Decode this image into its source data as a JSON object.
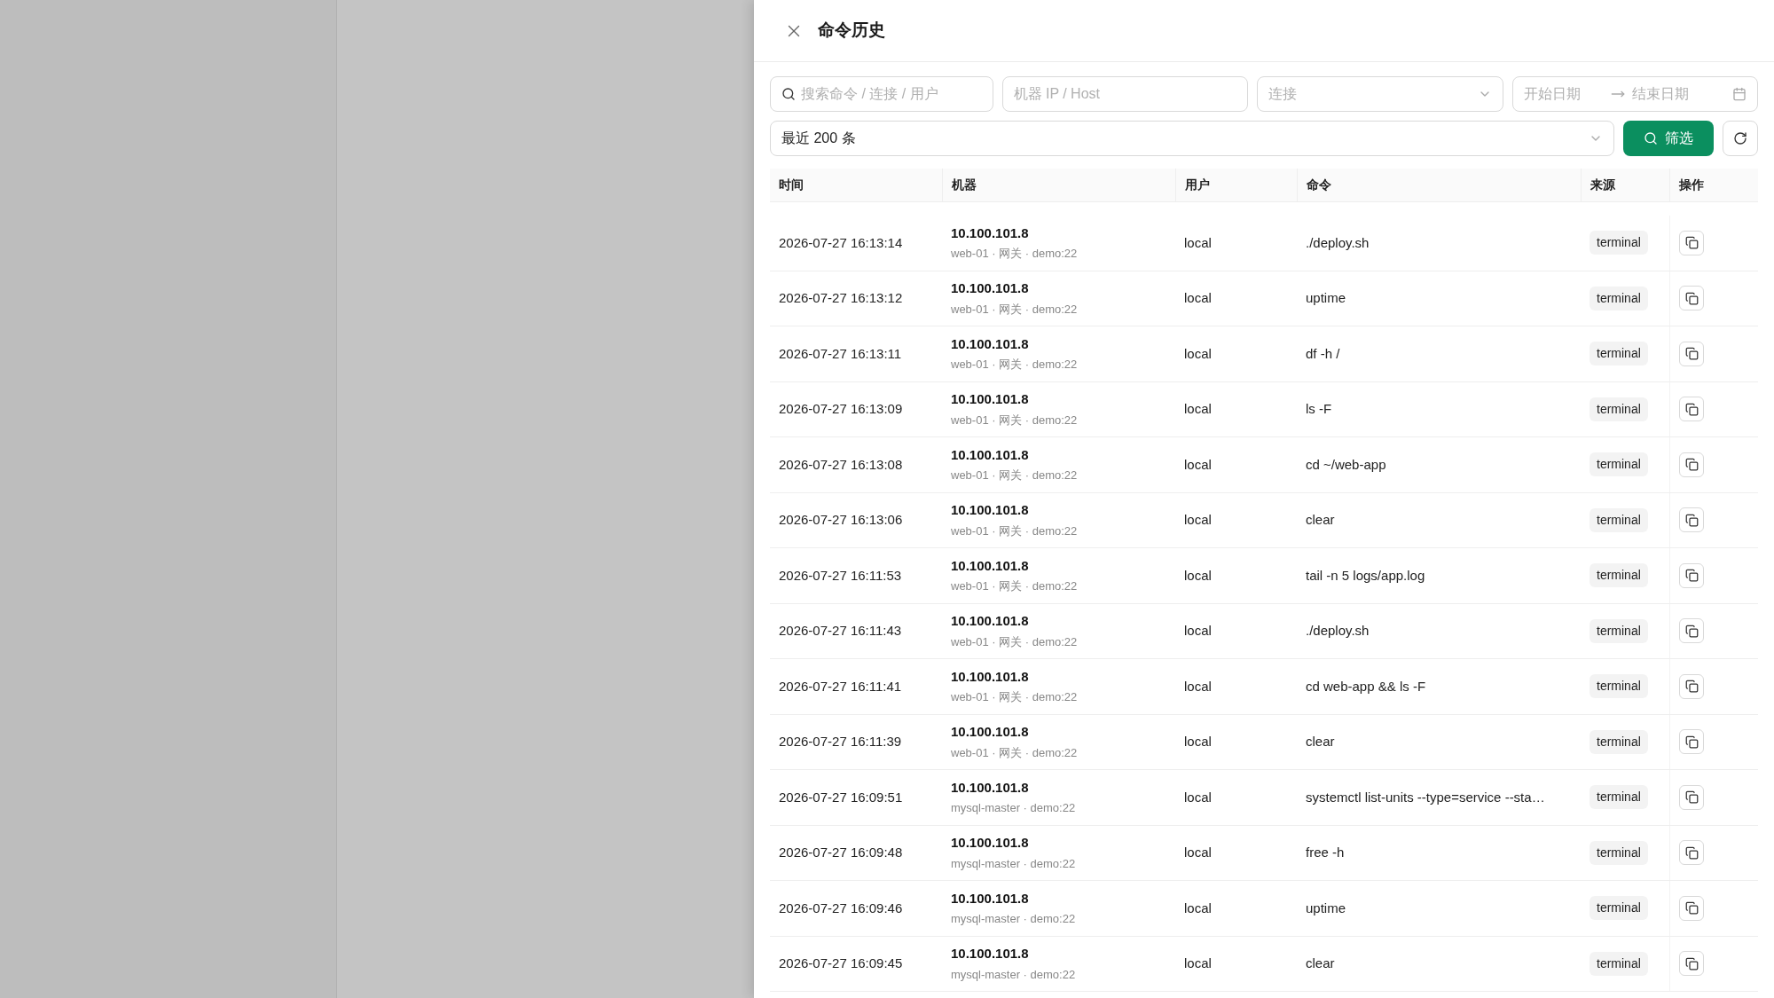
{
  "drawer": {
    "title": "命令历史"
  },
  "filters": {
    "search": {
      "placeholder": "搜索命令 / 连接 / 用户"
    },
    "host": {
      "placeholder": "机器 IP / Host"
    },
    "connection": {
      "placeholder": "连接"
    },
    "date_range": {
      "start_placeholder": "开始日期",
      "end_placeholder": "结束日期"
    },
    "limit": {
      "value": "最近 200 条"
    },
    "filter_button": "筛选"
  },
  "table": {
    "columns": [
      "时间",
      "机器",
      "用户",
      "命令",
      "来源",
      "操作"
    ],
    "rows": [
      {
        "time": "2026-07-27 16:13:14",
        "ip": "10.100.101.8",
        "machine": "web-01 · 网关 · demo:22",
        "user": "local",
        "command": "./deploy.sh",
        "source": "terminal"
      },
      {
        "time": "2026-07-27 16:13:12",
        "ip": "10.100.101.8",
        "machine": "web-01 · 网关 · demo:22",
        "user": "local",
        "command": "uptime",
        "source": "terminal"
      },
      {
        "time": "2026-07-27 16:13:11",
        "ip": "10.100.101.8",
        "machine": "web-01 · 网关 · demo:22",
        "user": "local",
        "command": "df -h /",
        "source": "terminal"
      },
      {
        "time": "2026-07-27 16:13:09",
        "ip": "10.100.101.8",
        "machine": "web-01 · 网关 · demo:22",
        "user": "local",
        "command": "ls -F",
        "source": "terminal"
      },
      {
        "time": "2026-07-27 16:13:08",
        "ip": "10.100.101.8",
        "machine": "web-01 · 网关 · demo:22",
        "user": "local",
        "command": "cd ~/web-app",
        "source": "terminal"
      },
      {
        "time": "2026-07-27 16:13:06",
        "ip": "10.100.101.8",
        "machine": "web-01 · 网关 · demo:22",
        "user": "local",
        "command": "clear",
        "source": "terminal"
      },
      {
        "time": "2026-07-27 16:11:53",
        "ip": "10.100.101.8",
        "machine": "web-01 · 网关 · demo:22",
        "user": "local",
        "command": "tail -n 5 logs/app.log",
        "source": "terminal"
      },
      {
        "time": "2026-07-27 16:11:43",
        "ip": "10.100.101.8",
        "machine": "web-01 · 网关 · demo:22",
        "user": "local",
        "command": "./deploy.sh",
        "source": "terminal"
      },
      {
        "time": "2026-07-27 16:11:41",
        "ip": "10.100.101.8",
        "machine": "web-01 · 网关 · demo:22",
        "user": "local",
        "command": "cd web-app && ls -F",
        "source": "terminal"
      },
      {
        "time": "2026-07-27 16:11:39",
        "ip": "10.100.101.8",
        "machine": "web-01 · 网关 · demo:22",
        "user": "local",
        "command": "clear",
        "source": "terminal"
      },
      {
        "time": "2026-07-27 16:09:51",
        "ip": "10.100.101.8",
        "machine": "mysql-master · demo:22",
        "user": "local",
        "command": "systemctl list-units --type=service --sta…",
        "source": "terminal"
      },
      {
        "time": "2026-07-27 16:09:48",
        "ip": "10.100.101.8",
        "machine": "mysql-master · demo:22",
        "user": "local",
        "command": "free -h",
        "source": "terminal"
      },
      {
        "time": "2026-07-27 16:09:46",
        "ip": "10.100.101.8",
        "machine": "mysql-master · demo:22",
        "user": "local",
        "command": "uptime",
        "source": "terminal"
      },
      {
        "time": "2026-07-27 16:09:45",
        "ip": "10.100.101.8",
        "machine": "mysql-master · demo:22",
        "user": "local",
        "command": "clear",
        "source": "terminal"
      }
    ]
  }
}
